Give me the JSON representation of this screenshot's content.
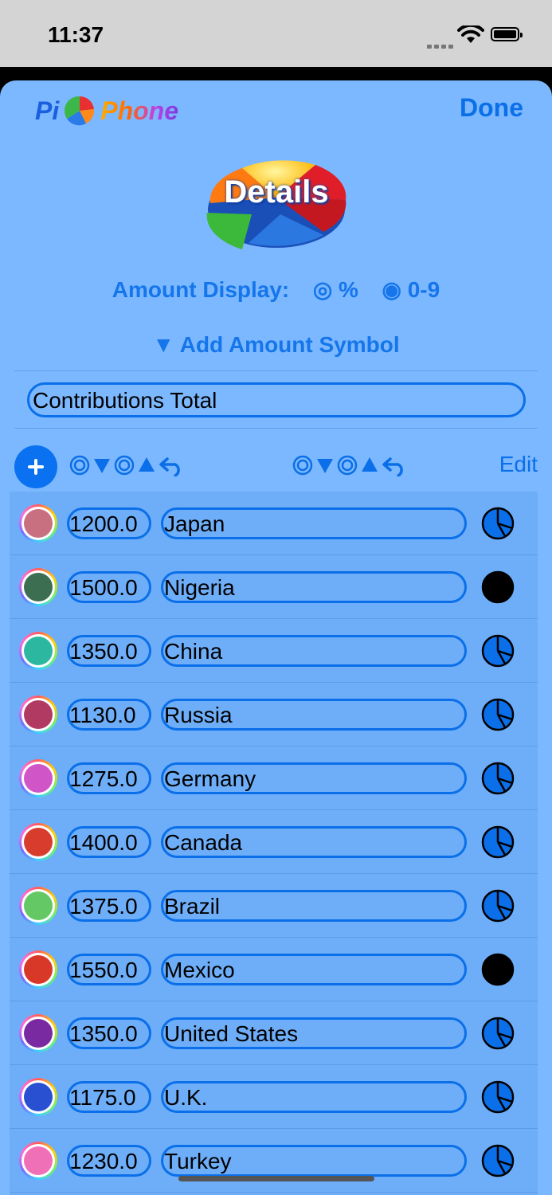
{
  "status": {
    "time": "11:37"
  },
  "header": {
    "logo_left": "Pi",
    "logo_right": "Phone",
    "done_label": "Done",
    "hero_label": "Details"
  },
  "amount_display": {
    "label": "Amount Display:",
    "options": [
      {
        "label": "%",
        "selected": false
      },
      {
        "label": "0-9",
        "selected": true
      }
    ]
  },
  "add_symbol_label": "▼ Add Amount Symbol",
  "title_field": {
    "value": "Contributions Total"
  },
  "toolbar": {
    "edit_label": "Edit"
  },
  "rows": [
    {
      "amount": "1200.0",
      "name": "Japan",
      "color": "#c87080",
      "highlight": false
    },
    {
      "amount": "1500.0",
      "name": "Nigeria",
      "color": "#3c6e52",
      "highlight": true
    },
    {
      "amount": "1350.0",
      "name": "China",
      "color": "#2cb8a0",
      "highlight": false
    },
    {
      "amount": "1130.0",
      "name": "Russia",
      "color": "#b03a62",
      "highlight": false
    },
    {
      "amount": "1275.0",
      "name": "Germany",
      "color": "#d056c8",
      "highlight": false
    },
    {
      "amount": "1400.0",
      "name": "Canada",
      "color": "#d83c2c",
      "highlight": false
    },
    {
      "amount": "1375.0",
      "name": "Brazil",
      "color": "#64c864",
      "highlight": false
    },
    {
      "amount": "1550.0",
      "name": "Mexico",
      "color": "#d83828",
      "highlight": true
    },
    {
      "amount": "1350.0",
      "name": "United States",
      "color": "#7a2aa0",
      "highlight": false
    },
    {
      "amount": "1175.0",
      "name": "U.K.",
      "color": "#2850d0",
      "highlight": false
    },
    {
      "amount": "1230.0",
      "name": "Turkey",
      "color": "#f070b8",
      "highlight": false
    }
  ]
}
